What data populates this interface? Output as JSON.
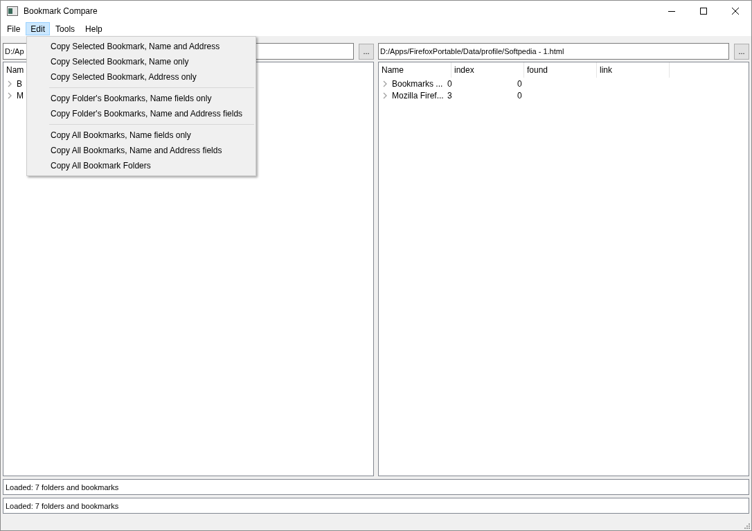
{
  "window": {
    "title": "Bookmark Compare"
  },
  "menu_bar": [
    {
      "label": "File",
      "selected": false
    },
    {
      "label": "Edit",
      "selected": true
    },
    {
      "label": "Tools",
      "selected": false
    },
    {
      "label": "Help",
      "selected": false
    }
  ],
  "edit_menu": {
    "groups": [
      [
        "Copy Selected Bookmark, Name and Address",
        "Copy Selected Bookmark, Name only",
        "Copy Selected Bookmark, Address only"
      ],
      [
        "Copy Folder's Bookmarks, Name fields only",
        "Copy Folder's Bookmarks, Name and Address fields"
      ],
      [
        "Copy All Bookmarks, Name fields only",
        "Copy All Bookmarks, Name and Address fields",
        "Copy All Bookmark Folders"
      ]
    ]
  },
  "left_pane": {
    "path": "D:/Ap",
    "browse_button": "...",
    "columns": [
      "Nam"
    ],
    "rows": [
      {
        "cells": [
          "B"
        ]
      },
      {
        "cells": [
          "M"
        ]
      }
    ]
  },
  "right_pane": {
    "path": "D:/Apps/FirefoxPortable/Data/profile/Softpedia - 1.html",
    "browse_button": "...",
    "columns": [
      "Name",
      "index",
      "found",
      "link"
    ],
    "rows": [
      {
        "cells": [
          "Bookmarks ...",
          "0",
          "0"
        ]
      },
      {
        "cells": [
          "Mozilla Firef...",
          "3",
          "0"
        ]
      }
    ]
  },
  "status_lines": [
    "Loaded: 7 folders and bookmarks",
    "Loaded: 7 folders and bookmarks"
  ]
}
